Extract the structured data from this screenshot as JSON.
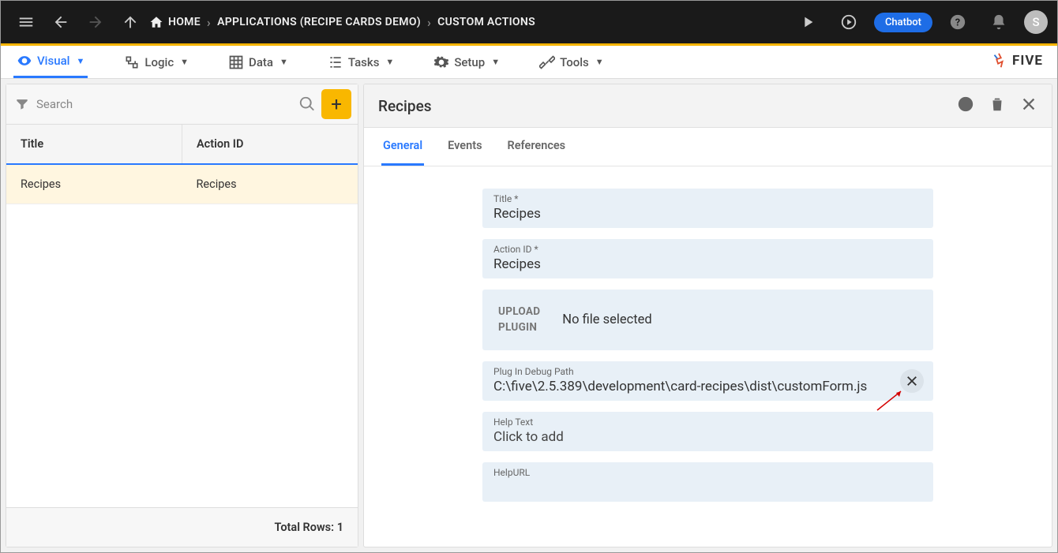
{
  "topbar": {
    "home": "HOME",
    "breadcrumb1": "APPLICATIONS (RECIPE CARDS DEMO)",
    "breadcrumb2": "CUSTOM ACTIONS",
    "chatbot": "Chatbot",
    "avatar_initial": "S"
  },
  "menubar": {
    "visual": "Visual",
    "logic": "Logic",
    "data": "Data",
    "tasks": "Tasks",
    "setup": "Setup",
    "tools": "Tools",
    "logo": "FIVE"
  },
  "left": {
    "search_placeholder": "Search",
    "col_title": "Title",
    "col_action_id": "Action ID",
    "rows": [
      {
        "title": "Recipes",
        "action_id": "Recipes"
      }
    ],
    "footer_label": "Total Rows:",
    "footer_count": "1"
  },
  "right": {
    "heading": "Recipes",
    "tabs": {
      "general": "General",
      "events": "Events",
      "references": "References"
    },
    "fields": {
      "title_label": "Title *",
      "title_value": "Recipes",
      "action_id_label": "Action ID *",
      "action_id_value": "Recipes",
      "upload_label_l1": "UPLOAD",
      "upload_label_l2": "PLUGIN",
      "upload_value": "No file selected",
      "debug_label": "Plug In Debug Path",
      "debug_value": "C:\\five\\2.5.389\\development\\card-recipes\\dist\\customForm.js",
      "help_text_label": "Help Text",
      "help_text_value": "Click to add",
      "help_url_label": "HelpURL",
      "help_url_value": ""
    }
  }
}
